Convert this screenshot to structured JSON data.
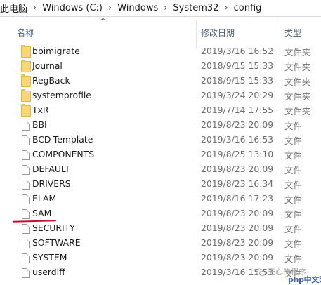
{
  "breadcrumb": [
    "此电脑",
    "Windows (C:)",
    "Windows",
    "System32",
    "config"
  ],
  "breadcrumb_separator": "›",
  "columns": {
    "name": "名称",
    "date": "修改日期",
    "type": "类型",
    "sort_indicator": "^"
  },
  "rows": [
    {
      "name": "bbimigrate",
      "date": "2019/3/16 16:52",
      "type": "文件夹",
      "icon": "folder-icon"
    },
    {
      "name": "Journal",
      "date": "2018/9/15 15:33",
      "type": "文件夹",
      "icon": "folder-icon"
    },
    {
      "name": "RegBack",
      "date": "2018/9/15 15:33",
      "type": "文件夹",
      "icon": "folder-icon"
    },
    {
      "name": "systemprofile",
      "date": "2019/3/24 20:29",
      "type": "文件夹",
      "icon": "folder-icon"
    },
    {
      "name": "TxR",
      "date": "2019/7/14 17:55",
      "type": "文件夹",
      "icon": "folder-icon"
    },
    {
      "name": "BBI",
      "date": "2019/8/23 20:09",
      "type": "文件",
      "icon": "file-icon"
    },
    {
      "name": "BCD-Template",
      "date": "2019/3/16 16:53",
      "type": "文件",
      "icon": "file-icon"
    },
    {
      "name": "COMPONENTS",
      "date": "2019/8/25 13:10",
      "type": "文件",
      "icon": "file-icon"
    },
    {
      "name": "DEFAULT",
      "date": "2019/8/23 20:09",
      "type": "文件",
      "icon": "file-icon"
    },
    {
      "name": "DRIVERS",
      "date": "2019/8/23 16:34",
      "type": "文件",
      "icon": "file-icon"
    },
    {
      "name": "ELAM",
      "date": "2019/8/16 17:23",
      "type": "文件",
      "icon": "file-icon"
    },
    {
      "name": "SAM",
      "date": "2019/8/23 20:09",
      "type": "文件",
      "icon": "file-icon"
    },
    {
      "name": "SECURITY",
      "date": "2019/8/23 20:09",
      "type": "文件",
      "icon": "file-icon"
    },
    {
      "name": "SOFTWARE",
      "date": "2019/8/23 20:09",
      "type": "文件",
      "icon": "file-icon"
    },
    {
      "name": "SYSTEM",
      "date": "2019/8/23 20:09",
      "type": "文件",
      "icon": "file-icon"
    },
    {
      "name": "userdiff",
      "date": "2019/3/16 15:53",
      "type": "文件",
      "icon": "file-icon"
    }
  ],
  "watermark": "无心的程序",
  "site_mark": "php中文网",
  "colors": {
    "annotation_underline": "#c8102e",
    "folder": "#f8d775"
  }
}
